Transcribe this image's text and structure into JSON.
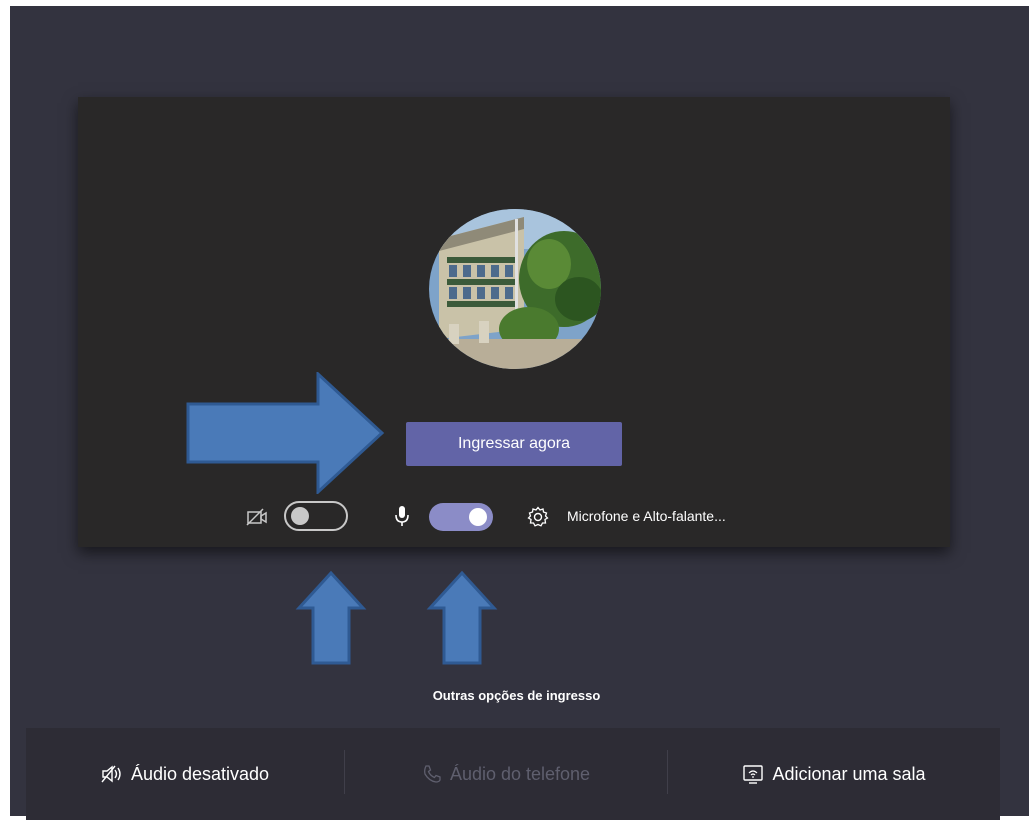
{
  "prejoin": {
    "join_button": "Ingressar agora",
    "camera_toggle_state": "off",
    "mic_toggle_state": "on",
    "device_settings_label": "Microfone e Alto-falante..."
  },
  "other_options": {
    "heading": "Outras opções de ingresso",
    "items": [
      {
        "label": "Áudio desativado",
        "icon": "speaker-off-icon",
        "enabled": true
      },
      {
        "label": "Áudio do telefone",
        "icon": "phone-icon",
        "enabled": false
      },
      {
        "label": "Adicionar uma sala",
        "icon": "room-cast-icon",
        "enabled": true
      }
    ]
  },
  "colors": {
    "background": "#33333f",
    "preview": "#292828",
    "accent": "#6264a7",
    "toggle_on": "#8b8cc7",
    "arrow_fill": "#4a7ab8",
    "arrow_stroke": "#2f5a93"
  }
}
